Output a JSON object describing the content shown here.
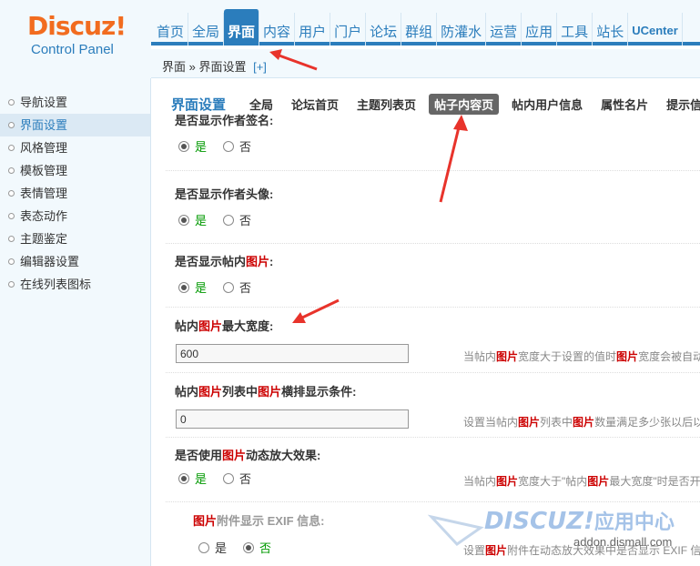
{
  "logo": {
    "main": "Discuz!",
    "sub": "Control Panel"
  },
  "nav": [
    "首页",
    "全局",
    "界面",
    "内容",
    "用户",
    "门户",
    "论坛",
    "群组",
    "防灌水",
    "运营",
    "应用",
    "工具",
    "站长",
    "UCenter"
  ],
  "breadcrumb": {
    "path": "界面 » 界面设置",
    "add": "[+]"
  },
  "sidebar": [
    "导航设置",
    "界面设置",
    "风格管理",
    "模板管理",
    "表情管理",
    "表态动作",
    "主题鉴定",
    "编辑器设置",
    "在线列表图标"
  ],
  "tabs": {
    "title": "界面设置",
    "items": [
      "全局",
      "论坛首页",
      "主题列表页",
      "帖子内容页",
      "帖内用户信息",
      "属性名片",
      "提示信息"
    ]
  },
  "options": {
    "yes": "是",
    "no": "否"
  },
  "settings": {
    "author_sig": {
      "label": "是否显示作者签名:"
    },
    "author_avatar": {
      "label": "是否显示作者头像:"
    },
    "show_img": {
      "label_a": "是否显示帖内",
      "label_b": "图片",
      "label_c": ":"
    },
    "img_width": {
      "label_a": "帖内",
      "label_b": "图片",
      "label_c": "最大宽度:",
      "value": "600",
      "tip_a": "当帖内",
      "tip_b": "图片",
      "tip_c": "宽度大于设置的值时",
      "tip_d": "图片",
      "tip_e": "宽度会被自动"
    },
    "img_list": {
      "label_a": "帖内",
      "label_b": "图片",
      "label_c": "列表中",
      "label_d": "图片",
      "label_e": "横排显示条件:",
      "value": "0",
      "tip_a": "设置当帖内",
      "tip_b": "图片",
      "tip_c": "列表中",
      "tip_d": "图片",
      "tip_e": "数量满足多少张以后以"
    },
    "img_zoom": {
      "label_a": "是否使用",
      "label_b": "图片",
      "label_c": "动态放大效果:",
      "tip_a": "当帖内",
      "tip_b": "图片",
      "tip_c": "宽度大于\"帖内",
      "tip_d": "图片",
      "tip_e": "最大宽度\"时是否开"
    },
    "exif": {
      "label_a": "图片",
      "label_b": "附件显示 EXIF 信息:",
      "tip_a": "设置",
      "tip_b": "图片",
      "tip_c": "附件在动态放大效果中是否显示 EXIF 信"
    }
  },
  "watermark": {
    "brand": "DISCUZ!",
    "cn": "应用中心",
    "site": "addon.dismall.com"
  },
  "colors": {
    "accent": "#2b7dbc",
    "highlight": "#cc0000",
    "arrow": "#e8332b",
    "logo": "#f26c1f"
  }
}
